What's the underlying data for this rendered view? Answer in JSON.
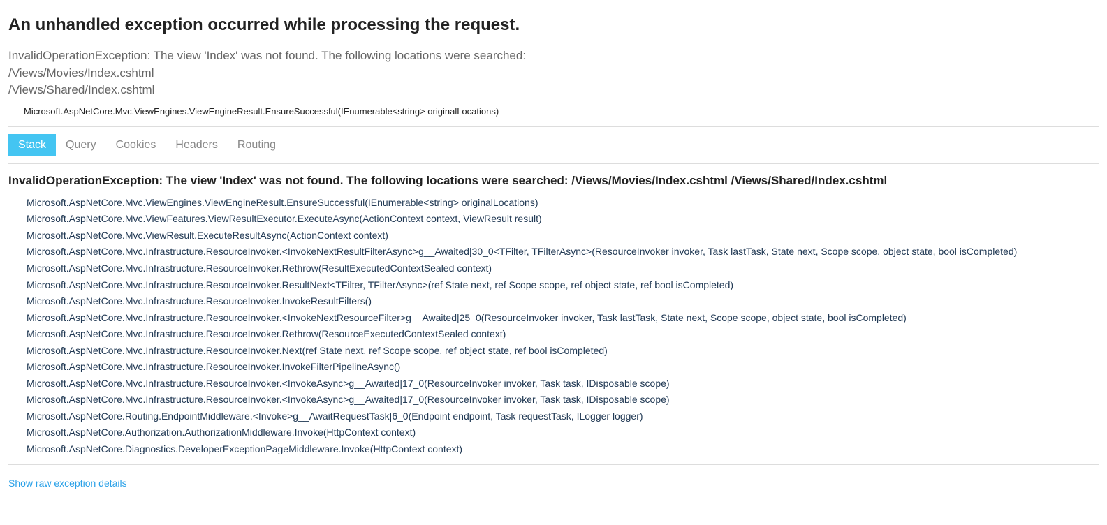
{
  "title": "An unhandled exception occurred while processing the request.",
  "summary": "InvalidOperationException: The view 'Index' was not found. The following locations were searched:\n/Views/Movies/Index.cshtml\n/Views/Shared/Index.cshtml",
  "top_frame": "Microsoft.AspNetCore.Mvc.ViewEngines.ViewEngineResult.EnsureSuccessful(IEnumerable<string> originalLocations)",
  "tabs": {
    "stack": "Stack",
    "query": "Query",
    "cookies": "Cookies",
    "headers": "Headers",
    "routing": "Routing"
  },
  "stack_heading": "InvalidOperationException: The view 'Index' was not found. The following locations were searched: /Views/Movies/Index.cshtml /Views/Shared/Index.cshtml",
  "frames": [
    "Microsoft.AspNetCore.Mvc.ViewEngines.ViewEngineResult.EnsureSuccessful(IEnumerable<string> originalLocations)",
    "Microsoft.AspNetCore.Mvc.ViewFeatures.ViewResultExecutor.ExecuteAsync(ActionContext context, ViewResult result)",
    "Microsoft.AspNetCore.Mvc.ViewResult.ExecuteResultAsync(ActionContext context)",
    "Microsoft.AspNetCore.Mvc.Infrastructure.ResourceInvoker.<InvokeNextResultFilterAsync>g__Awaited|30_0<TFilter, TFilterAsync>(ResourceInvoker invoker, Task lastTask, State next, Scope scope, object state, bool isCompleted)",
    "Microsoft.AspNetCore.Mvc.Infrastructure.ResourceInvoker.Rethrow(ResultExecutedContextSealed context)",
    "Microsoft.AspNetCore.Mvc.Infrastructure.ResourceInvoker.ResultNext<TFilter, TFilterAsync>(ref State next, ref Scope scope, ref object state, ref bool isCompleted)",
    "Microsoft.AspNetCore.Mvc.Infrastructure.ResourceInvoker.InvokeResultFilters()",
    "Microsoft.AspNetCore.Mvc.Infrastructure.ResourceInvoker.<InvokeNextResourceFilter>g__Awaited|25_0(ResourceInvoker invoker, Task lastTask, State next, Scope scope, object state, bool isCompleted)",
    "Microsoft.AspNetCore.Mvc.Infrastructure.ResourceInvoker.Rethrow(ResourceExecutedContextSealed context)",
    "Microsoft.AspNetCore.Mvc.Infrastructure.ResourceInvoker.Next(ref State next, ref Scope scope, ref object state, ref bool isCompleted)",
    "Microsoft.AspNetCore.Mvc.Infrastructure.ResourceInvoker.InvokeFilterPipelineAsync()",
    "Microsoft.AspNetCore.Mvc.Infrastructure.ResourceInvoker.<InvokeAsync>g__Awaited|17_0(ResourceInvoker invoker, Task task, IDisposable scope)",
    "Microsoft.AspNetCore.Mvc.Infrastructure.ResourceInvoker.<InvokeAsync>g__Awaited|17_0(ResourceInvoker invoker, Task task, IDisposable scope)",
    "Microsoft.AspNetCore.Routing.EndpointMiddleware.<Invoke>g__AwaitRequestTask|6_0(Endpoint endpoint, Task requestTask, ILogger logger)",
    "Microsoft.AspNetCore.Authorization.AuthorizationMiddleware.Invoke(HttpContext context)",
    "Microsoft.AspNetCore.Diagnostics.DeveloperExceptionPageMiddleware.Invoke(HttpContext context)"
  ],
  "show_raw": "Show raw exception details"
}
